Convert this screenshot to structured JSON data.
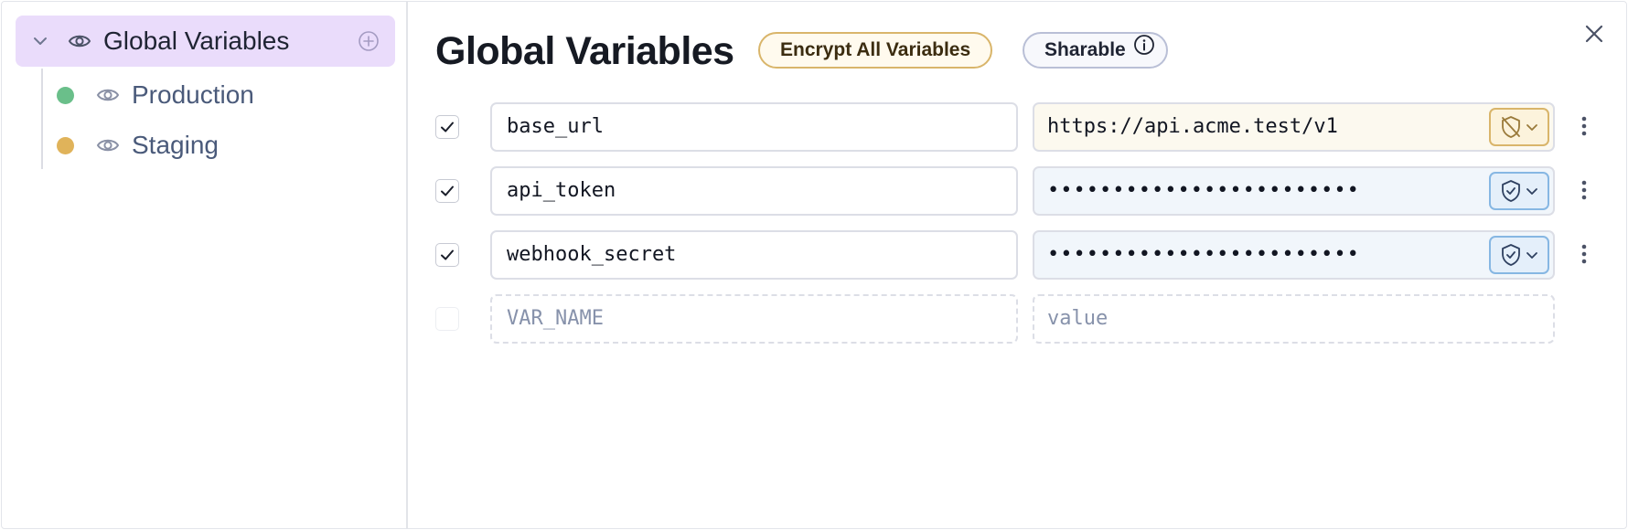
{
  "sidebar": {
    "root": {
      "label": "Global Variables"
    },
    "environments": [
      {
        "label": "Production",
        "color": "#6abf8a"
      },
      {
        "label": "Staging",
        "color": "#e0b35a"
      }
    ]
  },
  "main": {
    "title": "Global Variables",
    "encrypt_all_label": "Encrypt All Variables",
    "sharable_label": "Sharable",
    "variables": [
      {
        "enabled": true,
        "name": "base_url",
        "value": "https://api.acme.test/v1",
        "encrypted": false
      },
      {
        "enabled": true,
        "name": "api_token",
        "value": "••••••••••••••••••••••••",
        "encrypted": true
      },
      {
        "enabled": true,
        "name": "webhook_secret",
        "value": "••••••••••••••••••••••••",
        "encrypted": true
      }
    ],
    "new_row": {
      "name_placeholder": "VAR_NAME",
      "value_placeholder": "value"
    }
  },
  "colors": {
    "root_highlight": "#eadcfb",
    "encrypt_button_border": "#d9b56a",
    "encrypted_field_bg": "#f1f6fb"
  }
}
